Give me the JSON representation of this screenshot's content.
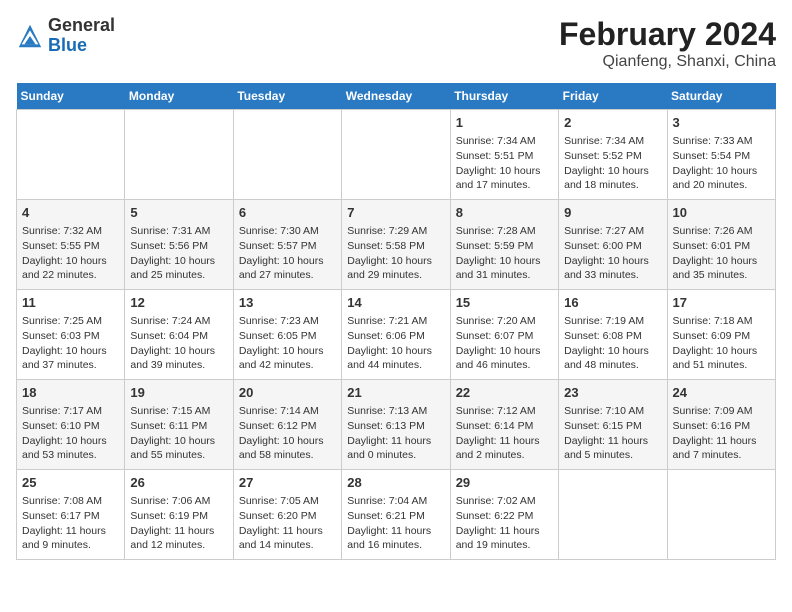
{
  "logo": {
    "general": "General",
    "blue": "Blue"
  },
  "title": "February 2024",
  "subtitle": "Qianfeng, Shanxi, China",
  "days": [
    "Sunday",
    "Monday",
    "Tuesday",
    "Wednesday",
    "Thursday",
    "Friday",
    "Saturday"
  ],
  "weeks": [
    [
      {
        "num": "",
        "info": ""
      },
      {
        "num": "",
        "info": ""
      },
      {
        "num": "",
        "info": ""
      },
      {
        "num": "",
        "info": ""
      },
      {
        "num": "1",
        "info": "Sunrise: 7:34 AM\nSunset: 5:51 PM\nDaylight: 10 hours and 17 minutes."
      },
      {
        "num": "2",
        "info": "Sunrise: 7:34 AM\nSunset: 5:52 PM\nDaylight: 10 hours and 18 minutes."
      },
      {
        "num": "3",
        "info": "Sunrise: 7:33 AM\nSunset: 5:54 PM\nDaylight: 10 hours and 20 minutes."
      }
    ],
    [
      {
        "num": "4",
        "info": "Sunrise: 7:32 AM\nSunset: 5:55 PM\nDaylight: 10 hours and 22 minutes."
      },
      {
        "num": "5",
        "info": "Sunrise: 7:31 AM\nSunset: 5:56 PM\nDaylight: 10 hours and 25 minutes."
      },
      {
        "num": "6",
        "info": "Sunrise: 7:30 AM\nSunset: 5:57 PM\nDaylight: 10 hours and 27 minutes."
      },
      {
        "num": "7",
        "info": "Sunrise: 7:29 AM\nSunset: 5:58 PM\nDaylight: 10 hours and 29 minutes."
      },
      {
        "num": "8",
        "info": "Sunrise: 7:28 AM\nSunset: 5:59 PM\nDaylight: 10 hours and 31 minutes."
      },
      {
        "num": "9",
        "info": "Sunrise: 7:27 AM\nSunset: 6:00 PM\nDaylight: 10 hours and 33 minutes."
      },
      {
        "num": "10",
        "info": "Sunrise: 7:26 AM\nSunset: 6:01 PM\nDaylight: 10 hours and 35 minutes."
      }
    ],
    [
      {
        "num": "11",
        "info": "Sunrise: 7:25 AM\nSunset: 6:03 PM\nDaylight: 10 hours and 37 minutes."
      },
      {
        "num": "12",
        "info": "Sunrise: 7:24 AM\nSunset: 6:04 PM\nDaylight: 10 hours and 39 minutes."
      },
      {
        "num": "13",
        "info": "Sunrise: 7:23 AM\nSunset: 6:05 PM\nDaylight: 10 hours and 42 minutes."
      },
      {
        "num": "14",
        "info": "Sunrise: 7:21 AM\nSunset: 6:06 PM\nDaylight: 10 hours and 44 minutes."
      },
      {
        "num": "15",
        "info": "Sunrise: 7:20 AM\nSunset: 6:07 PM\nDaylight: 10 hours and 46 minutes."
      },
      {
        "num": "16",
        "info": "Sunrise: 7:19 AM\nSunset: 6:08 PM\nDaylight: 10 hours and 48 minutes."
      },
      {
        "num": "17",
        "info": "Sunrise: 7:18 AM\nSunset: 6:09 PM\nDaylight: 10 hours and 51 minutes."
      }
    ],
    [
      {
        "num": "18",
        "info": "Sunrise: 7:17 AM\nSunset: 6:10 PM\nDaylight: 10 hours and 53 minutes."
      },
      {
        "num": "19",
        "info": "Sunrise: 7:15 AM\nSunset: 6:11 PM\nDaylight: 10 hours and 55 minutes."
      },
      {
        "num": "20",
        "info": "Sunrise: 7:14 AM\nSunset: 6:12 PM\nDaylight: 10 hours and 58 minutes."
      },
      {
        "num": "21",
        "info": "Sunrise: 7:13 AM\nSunset: 6:13 PM\nDaylight: 11 hours and 0 minutes."
      },
      {
        "num": "22",
        "info": "Sunrise: 7:12 AM\nSunset: 6:14 PM\nDaylight: 11 hours and 2 minutes."
      },
      {
        "num": "23",
        "info": "Sunrise: 7:10 AM\nSunset: 6:15 PM\nDaylight: 11 hours and 5 minutes."
      },
      {
        "num": "24",
        "info": "Sunrise: 7:09 AM\nSunset: 6:16 PM\nDaylight: 11 hours and 7 minutes."
      }
    ],
    [
      {
        "num": "25",
        "info": "Sunrise: 7:08 AM\nSunset: 6:17 PM\nDaylight: 11 hours and 9 minutes."
      },
      {
        "num": "26",
        "info": "Sunrise: 7:06 AM\nSunset: 6:19 PM\nDaylight: 11 hours and 12 minutes."
      },
      {
        "num": "27",
        "info": "Sunrise: 7:05 AM\nSunset: 6:20 PM\nDaylight: 11 hours and 14 minutes."
      },
      {
        "num": "28",
        "info": "Sunrise: 7:04 AM\nSunset: 6:21 PM\nDaylight: 11 hours and 16 minutes."
      },
      {
        "num": "29",
        "info": "Sunrise: 7:02 AM\nSunset: 6:22 PM\nDaylight: 11 hours and 19 minutes."
      },
      {
        "num": "",
        "info": ""
      },
      {
        "num": "",
        "info": ""
      }
    ]
  ]
}
